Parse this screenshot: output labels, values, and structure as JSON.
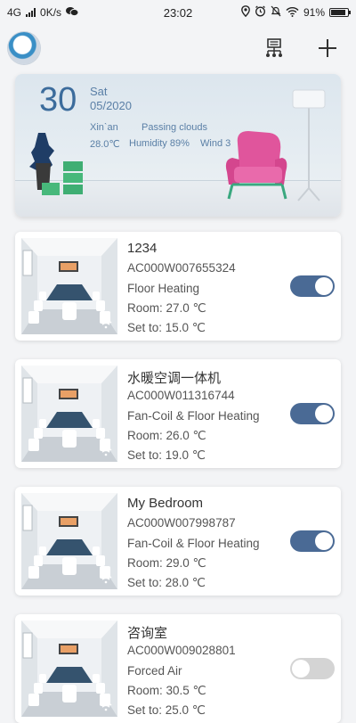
{
  "status_bar": {
    "network": "4G",
    "speed": "0K/s",
    "time": "23:02",
    "battery": "91%",
    "battery_level": 0.91
  },
  "header": {
    "avatar_icon": "robot-avatar-icon",
    "devices_icon": "device-network-icon",
    "add_icon": "plus-icon"
  },
  "weather": {
    "day": "30",
    "weekday": "Sat",
    "date": "05/2020",
    "city": "Xinˋan",
    "condition": "Passing clouds",
    "temperature": "28.0℃",
    "humidity": "Humidity 89%",
    "wind": "Wind 3"
  },
  "labels": {
    "room_prefix": "Room: ",
    "set_prefix": "Set to: "
  },
  "devices": [
    {
      "name": "1234",
      "code": "AC000W007655324",
      "type": "Floor Heating",
      "room": "Room: 27.0 ℃",
      "set_to": "Set to: 15.0 ℃",
      "on": true
    },
    {
      "name": "水暖空调一体机",
      "code": "AC000W011316744",
      "type": "Fan-Coil & Floor Heating",
      "room": "Room: 26.0 ℃",
      "set_to": "Set to: 19.0 ℃",
      "on": true
    },
    {
      "name": "My Bedroom",
      "code": "AC000W007998787",
      "type": "Fan-Coil & Floor Heating",
      "room": "Room: 29.0 ℃",
      "set_to": "Set to: 28.0 ℃",
      "on": true
    },
    {
      "name": "咨询室",
      "code": "AC000W009028801",
      "type": "Forced Air",
      "room": "Room: 30.5 ℃",
      "set_to": "Set to: 25.0 ℃",
      "on": false
    }
  ],
  "colors": {
    "toggle_on": "#4a6a95",
    "toggle_off": "#d4d4d4",
    "weather_text": "#5a7fa6",
    "chair": "#e0559c"
  }
}
